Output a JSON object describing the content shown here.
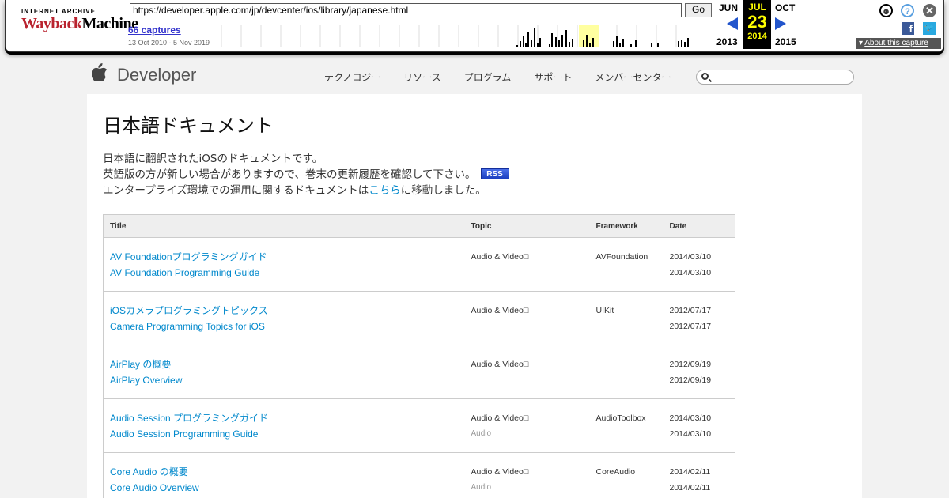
{
  "wayback": {
    "logo_top": "INTERNET ARCHIVE",
    "logo_a": "Wayback",
    "logo_b": "Machine",
    "url": "https://developer.apple.com/jp/devcenter/ios/library/japanese.html",
    "go_label": "Go",
    "captures": "66 captures",
    "range": "13 Oct 2010 - 5 Nov 2019",
    "prev_month": "JUN",
    "prev_year": "2013",
    "cur_month": "JUL",
    "cur_day": "23",
    "cur_year": "2014",
    "next_month": "OCT",
    "next_year": "2015",
    "about": "About this capture",
    "sparkline": [
      0,
      0,
      0,
      0,
      0,
      0,
      0,
      0,
      0,
      0,
      0,
      0,
      0,
      0,
      0,
      0,
      0,
      0,
      0,
      0,
      0,
      0,
      0,
      0,
      0,
      0,
      0,
      0,
      0,
      0,
      0,
      0,
      0,
      0,
      0,
      0,
      0,
      0,
      0,
      0,
      0,
      0,
      0,
      0,
      0,
      0,
      0,
      0,
      0,
      0,
      0,
      0,
      0,
      0,
      0,
      0,
      0,
      0,
      0,
      0,
      0,
      0,
      0,
      0,
      0,
      0,
      0,
      0,
      0,
      0,
      0,
      0,
      0,
      0,
      0,
      0,
      0,
      0,
      0,
      0,
      0,
      0,
      0,
      0,
      0,
      0,
      0,
      0,
      0,
      0,
      0,
      0,
      0,
      0,
      0,
      0,
      0,
      0,
      0,
      0,
      0,
      0,
      0,
      0,
      0,
      0,
      0,
      0,
      0,
      0,
      0,
      0,
      0,
      0,
      0,
      0,
      0,
      0,
      0,
      0,
      0,
      0,
      0,
      0,
      0,
      0,
      0,
      0,
      0,
      0,
      0,
      0,
      0,
      0,
      0,
      0,
      0,
      0,
      0,
      0,
      0,
      0,
      0,
      0,
      0,
      0,
      0,
      0,
      0,
      0,
      0,
      0,
      0,
      0,
      0,
      0,
      0,
      0,
      0,
      0,
      0,
      0,
      0,
      0,
      0,
      0,
      0,
      0,
      0,
      0,
      0,
      0,
      0,
      0,
      0,
      0,
      0,
      0,
      0,
      0,
      0,
      0,
      0,
      0,
      0,
      0,
      0,
      0,
      0,
      0,
      0,
      0,
      0,
      0,
      0,
      0,
      0,
      0,
      0,
      0,
      0,
      0,
      0,
      0,
      0,
      0,
      0,
      0,
      0,
      0,
      0,
      0,
      0,
      0,
      0,
      0,
      0,
      0,
      0,
      0,
      0,
      0,
      0,
      0,
      0,
      0,
      0,
      0,
      0,
      0,
      0,
      0,
      0,
      0,
      0,
      0,
      0,
      0,
      0,
      0,
      0,
      0,
      0,
      0,
      0,
      0,
      0,
      0,
      0,
      0,
      0,
      0,
      0,
      0,
      0,
      0,
      0,
      0,
      0,
      0,
      0,
      0,
      0,
      0,
      0,
      0,
      0,
      0,
      0,
      0,
      0,
      0,
      0,
      0,
      0,
      0,
      0,
      0,
      0,
      0,
      0,
      0,
      0,
      0,
      0,
      0,
      0,
      0,
      0,
      0,
      0,
      0,
      0,
      0,
      0,
      0,
      0,
      0,
      0,
      0,
      0,
      0,
      0,
      0,
      0,
      0,
      0,
      0,
      0,
      0,
      0,
      0,
      0,
      0,
      0,
      0,
      0,
      0,
      0,
      0,
      0,
      0,
      0,
      0,
      0,
      0,
      0,
      0,
      0,
      0,
      0,
      0,
      0,
      0,
      0,
      0,
      0,
      0,
      0,
      0,
      0,
      0,
      0,
      0,
      0,
      0,
      0,
      0,
      0,
      0,
      0,
      0,
      0,
      0,
      0,
      0,
      0,
      0,
      0,
      0,
      0,
      0,
      0,
      0,
      0,
      0,
      0,
      0,
      0,
      0,
      0,
      0,
      0,
      0,
      0,
      0,
      0,
      0,
      0,
      0,
      0,
      0,
      0,
      0,
      0,
      0,
      0,
      0,
      0,
      0,
      0,
      0,
      0,
      0,
      0,
      0,
      0,
      0,
      0,
      0,
      0,
      0,
      0,
      0,
      0,
      0,
      0,
      0,
      0,
      0,
      0,
      0,
      0,
      0,
      0,
      0,
      0,
      0,
      0,
      0,
      0,
      0,
      0,
      0,
      0,
      0,
      0,
      0,
      0,
      0,
      0,
      0,
      0,
      0,
      0,
      0,
      0,
      0,
      0,
      0,
      0,
      0,
      0,
      0,
      0,
      0,
      0,
      0,
      0,
      0,
      0,
      0,
      0,
      0,
      0,
      0,
      0,
      0,
      0,
      0,
      0,
      0,
      0,
      0,
      0,
      0,
      0,
      0,
      0,
      0,
      0,
      0,
      0,
      0,
      0,
      0,
      0,
      0,
      0,
      0,
      0,
      0,
      0,
      0,
      0,
      0,
      0,
      0,
      0,
      0,
      0,
      0,
      0,
      0,
      0,
      0,
      0,
      0,
      0,
      0,
      0,
      0,
      0,
      0,
      0,
      0,
      0,
      0,
      0,
      0,
      0,
      0,
      0,
      0,
      0,
      0,
      0,
      0,
      0,
      0,
      0,
      0,
      0,
      0,
      0,
      0,
      0,
      0,
      0,
      0,
      0,
      0,
      0,
      0,
      0,
      0,
      0,
      0,
      0,
      0,
      0,
      0,
      0,
      0,
      0,
      0,
      0,
      0,
      0,
      0,
      0,
      0,
      0,
      0,
      0,
      0,
      0,
      0,
      0,
      0,
      0,
      0,
      0,
      0,
      0,
      0,
      0,
      0,
      0,
      0,
      0,
      0,
      0,
      0,
      0,
      0,
      0,
      0,
      0,
      0,
      0,
      0,
      0,
      0,
      0,
      0,
      0,
      0,
      0,
      0,
      0,
      0,
      0,
      0,
      0,
      0,
      0,
      0,
      0,
      0,
      0,
      0,
      0,
      0,
      0,
      0,
      0,
      0,
      0,
      0,
      0,
      0,
      0,
      0,
      0,
      0,
      0,
      0,
      0,
      0,
      0,
      0,
      0,
      0,
      0,
      0,
      0,
      0,
      0,
      0,
      0,
      0,
      0,
      0,
      0,
      0,
      0,
      0,
      0,
      0,
      0,
      0,
      0,
      0,
      0,
      0,
      0,
      0,
      0
    ]
  },
  "header": {
    "brand": "Developer",
    "nav": [
      "テクノロジー",
      "リソース",
      "プログラム",
      "サポート",
      "メンバーセンター"
    ],
    "search_placeholder": ""
  },
  "page": {
    "title": "日本語ドキュメント",
    "intro_line1": "日本語に翻訳されたiOSのドキュメントです。",
    "intro_line2": "英語版の方が新しい場合がありますので、巻末の更新履歴を確認して下さい。",
    "rss": "RSS",
    "intro_line3_pre": "エンタープライズ環境での運用に関するドキュメントは",
    "intro_line3_link": "こちら",
    "intro_line3_post": "に移動しました。"
  },
  "table": {
    "headers": [
      "Title",
      "Topic",
      "Framework",
      "Date"
    ],
    "rows": [
      {
        "title_ja": "AV Foundationプログラミングガイド",
        "title_en": "AV Foundation Programming Guide",
        "topic": "Audio & Video□",
        "subtopic": "",
        "framework": "AVFoundation",
        "date1": "2014/03/10",
        "date2": "2014/03/10"
      },
      {
        "title_ja": "iOSカメラプログラミングトピックス",
        "title_en": "Camera Programming Topics for iOS",
        "topic": "Audio & Video□",
        "subtopic": "",
        "framework": "UIKit",
        "date1": "2012/07/17",
        "date2": "2012/07/17"
      },
      {
        "title_ja": "AirPlay の概要",
        "title_en": "AirPlay Overview",
        "topic": "Audio & Video□",
        "subtopic": "",
        "framework": "",
        "date1": "2012/09/19",
        "date2": "2012/09/19"
      },
      {
        "title_ja": "Audio Session プログラミングガイド",
        "title_en": "Audio Session Programming Guide",
        "topic": "Audio & Video□",
        "subtopic": "Audio",
        "framework": "AudioToolbox",
        "date1": "2014/03/10",
        "date2": "2014/03/10"
      },
      {
        "title_ja": "Core Audio の概要",
        "title_en": "Core Audio Overview",
        "topic": "Audio & Video□",
        "subtopic": "Audio",
        "framework": "CoreAudio",
        "date1": "2014/02/11",
        "date2": "2014/02/11"
      }
    ]
  }
}
